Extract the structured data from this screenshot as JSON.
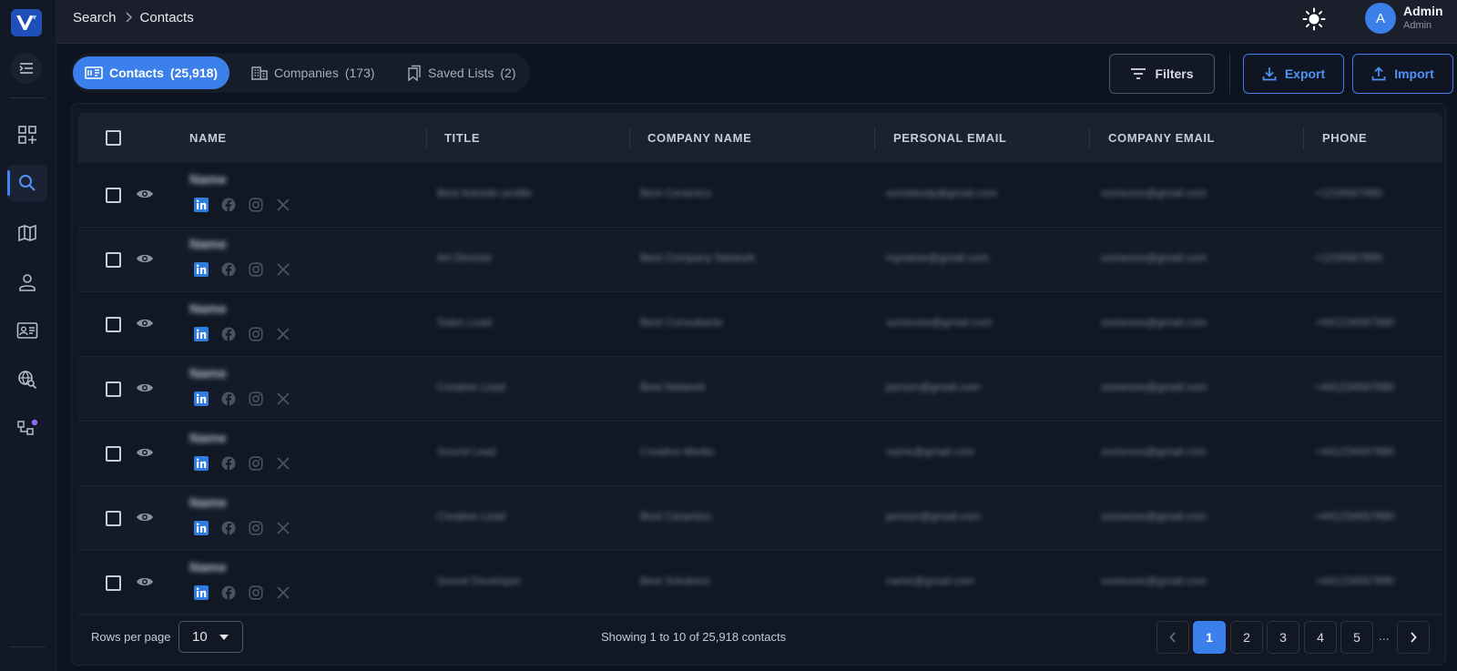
{
  "breadcrumb": {
    "root": "Search",
    "current": "Contacts"
  },
  "user": {
    "initial": "A",
    "name": "Admin",
    "role": "Admin"
  },
  "tabs": [
    {
      "label": "Contacts",
      "count": "(25,918)",
      "icon": "contacts-card-icon",
      "active": true
    },
    {
      "label": "Companies",
      "count": "(173)",
      "icon": "building-icon",
      "active": false
    },
    {
      "label": "Saved Lists",
      "count": "(2)",
      "icon": "bookmarks-icon",
      "active": false
    }
  ],
  "actions": {
    "filters": "Filters",
    "export": "Export",
    "import": "Import"
  },
  "table": {
    "headers": [
      "NAME",
      "TITLE",
      "COMPANY NAME",
      "PERSONAL EMAIL",
      "COMPANY EMAIL",
      "PHONE"
    ],
    "rows": [
      {
        "name": "Name",
        "title": "Best linkedin profile",
        "company": "Best Ceramics",
        "personal_email": "somebody@gmail.com",
        "company_email": "someone@gmail.com",
        "phone": "+1234567890"
      },
      {
        "name": "Name",
        "title": "Art Director",
        "company": "Best Company Network",
        "personal_email": "myname@gmail.com",
        "company_email": "someone@gmail.com",
        "phone": "+1234567890"
      },
      {
        "name": "Name",
        "title": "Sales Lead",
        "company": "Best Consultants",
        "personal_email": "someone@gmail.com",
        "company_email": "someone@gmail.com",
        "phone": "+441234567890"
      },
      {
        "name": "Name",
        "title": "Creative Lead",
        "company": "Best Network",
        "personal_email": "person@gmail.com",
        "company_email": "someone@gmail.com",
        "phone": "+441234567890"
      },
      {
        "name": "Name",
        "title": "Sound Lead",
        "company": "Creative Media",
        "personal_email": "name@gmail.com",
        "company_email": "someone@gmail.com",
        "phone": "+441234567890"
      },
      {
        "name": "Name",
        "title": "Creative Lead",
        "company": "Best Ceramics",
        "personal_email": "person@gmail.com",
        "company_email": "someone@gmail.com",
        "phone": "+441234567890"
      },
      {
        "name": "Name",
        "title": "Sound Developer",
        "company": "Best Solutions",
        "personal_email": "name@gmail.com",
        "company_email": "someone@gmail.com",
        "phone": "+441234567890"
      }
    ]
  },
  "footer": {
    "rows_per_page_label": "Rows per page",
    "rows_per_page_value": "10",
    "showing": "Showing 1 to 10 of 25,918 contacts",
    "pages": [
      "1",
      "2",
      "3",
      "4",
      "5"
    ],
    "ellipsis": "...",
    "active_page": "1"
  },
  "colors": {
    "accent": "#3a7fea",
    "background": "#0e1320",
    "linkedin": "#2f7de1"
  }
}
